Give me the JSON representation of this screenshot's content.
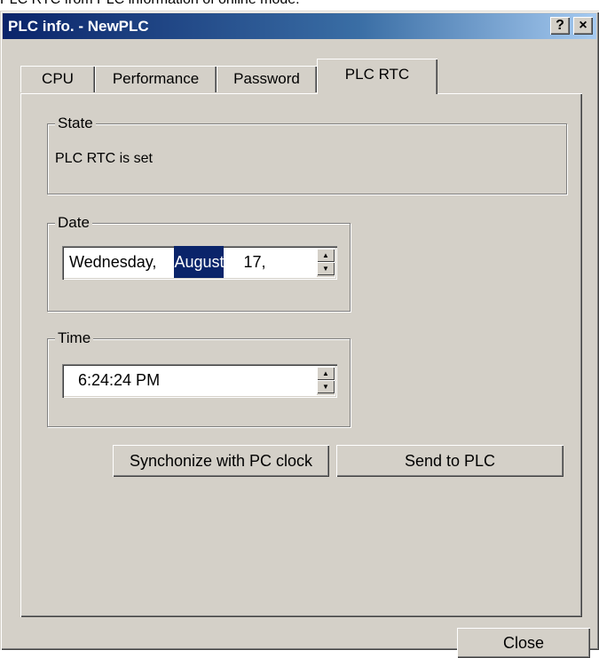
{
  "doc_caption": "PLC RTC from PLC information of online mode.",
  "window": {
    "title": "PLC info. - NewPLC",
    "help_label": "?",
    "close_label": "×"
  },
  "tabs": [
    "CPU",
    "Performance",
    "Password",
    "PLC RTC"
  ],
  "active_tab": "PLC RTC",
  "state": {
    "legend": "State",
    "text": "PLC RTC is set"
  },
  "date": {
    "legend": "Date",
    "weekday": "Wednesday,",
    "month": "August",
    "day": "17,"
  },
  "time": {
    "legend": "Time",
    "value": "6:24:24 PM"
  },
  "buttons": {
    "sync": "Synchonize with PC clock",
    "send": "Send to PLC",
    "close": "Close"
  }
}
